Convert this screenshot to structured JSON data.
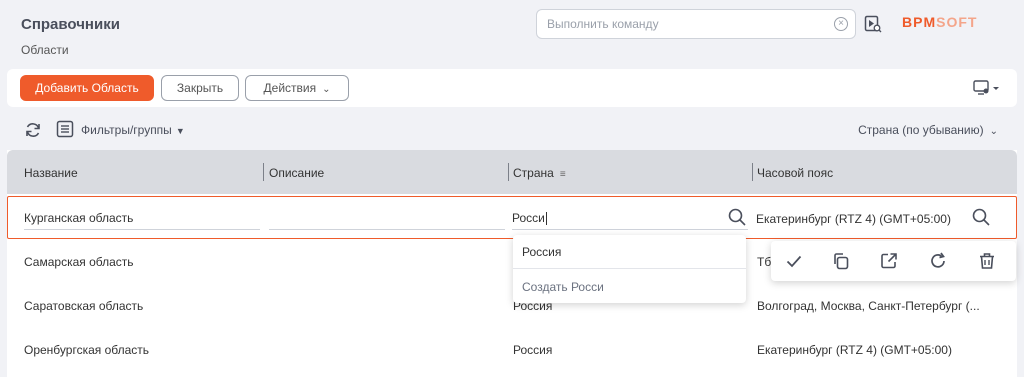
{
  "header": {
    "title": "Справочники",
    "subtitle": "Области",
    "command_placeholder": "Выполнить команду",
    "logo_bpm": "BPM",
    "logo_soft": "SOFT"
  },
  "toolbar": {
    "add_label": "Добавить Область",
    "close_label": "Закрыть",
    "actions_label": "Действия"
  },
  "filters": {
    "filter_label": "Фильтры/группы",
    "sort_label": "Страна (по убыванию)"
  },
  "grid": {
    "columns": [
      "Название",
      "Описание",
      "Страна",
      "Часовой пояс"
    ],
    "edit_row": {
      "name": "Курганская область",
      "description": "",
      "country": "Росси",
      "timezone": "Екатеринбург (RTZ 4) (GMT+05:00)"
    },
    "rows": [
      {
        "name": "Самарская область",
        "country": "",
        "timezone": "Тбі"
      },
      {
        "name": "Саратовская область",
        "country": "Россия",
        "timezone": "Волгоград, Москва, Санкт-Петербург (..."
      },
      {
        "name": "Оренбургская область",
        "country": "Россия",
        "timezone": "Екатеринбург (RTZ 4) (GMT+05:00)"
      }
    ]
  },
  "dropdown": {
    "option": "Россия",
    "create": "Создать Росси"
  },
  "colors": {
    "accent": "#ef5b2b",
    "header_bg": "#d9dbe0",
    "page_bg": "#f1f2f6"
  },
  "icons": [
    "clear-icon",
    "video-help-icon",
    "view-settings-icon",
    "refresh-icon",
    "filter-icon",
    "sort-icon",
    "search-icon",
    "check-icon",
    "copy-icon",
    "open-icon",
    "cancel-icon",
    "delete-icon"
  ]
}
